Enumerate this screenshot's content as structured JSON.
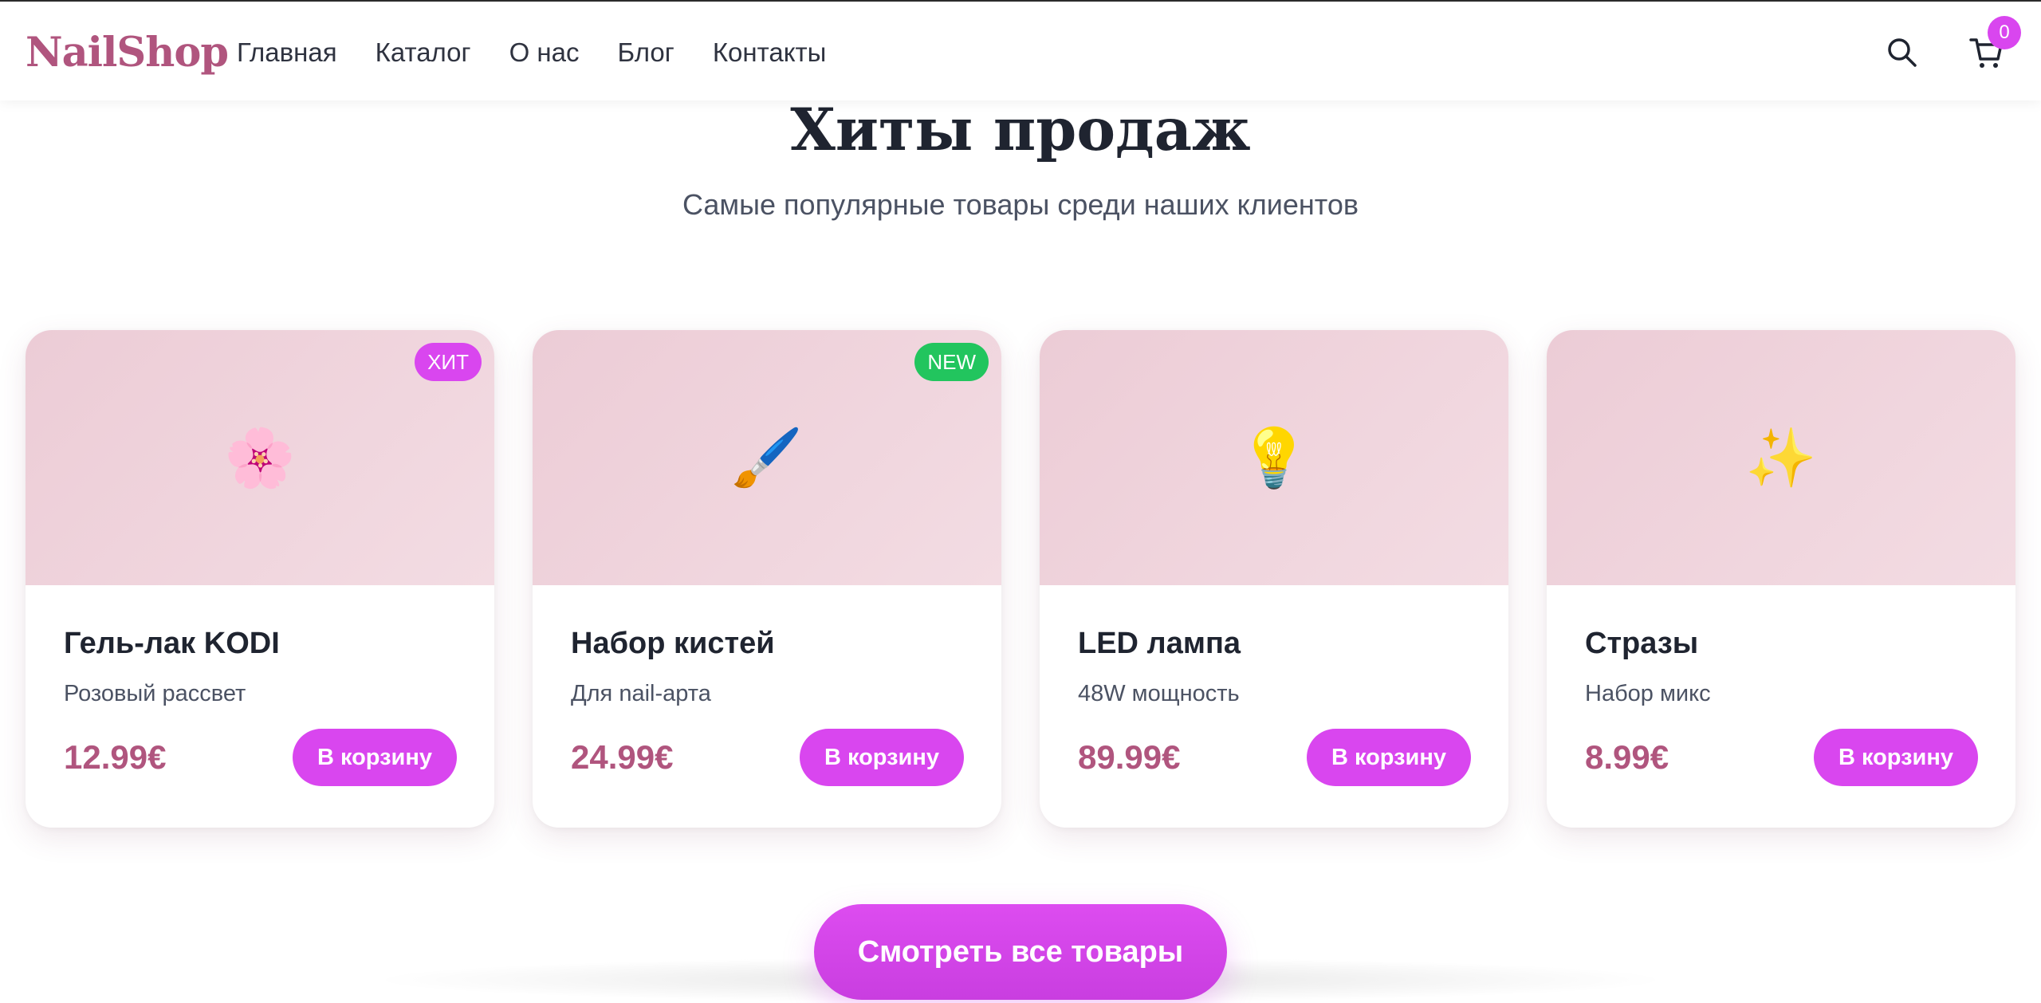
{
  "header": {
    "logo": "NailShop",
    "nav": [
      "Главная",
      "Каталог",
      "О нас",
      "Блог",
      "Контакты"
    ],
    "cart_count": "0"
  },
  "section": {
    "title": "Хиты продаж",
    "subtitle": "Самые популярные товары среди наших клиентов"
  },
  "products": [
    {
      "name": "Гель-лак KODI",
      "description": "Розовый рассвет",
      "price": "12.99€",
      "emoji": "🌸",
      "badge": "ХИТ",
      "badge_color": "#d946ef",
      "button": "В корзину"
    },
    {
      "name": "Набор кистей",
      "description": "Для nail-арта",
      "price": "24.99€",
      "emoji": "🖌️",
      "badge": "NEW",
      "badge_color": "#22c55e",
      "button": "В корзину"
    },
    {
      "name": "LED лампа",
      "description": "48W мощность",
      "price": "89.99€",
      "emoji": "💡",
      "badge": "",
      "badge_color": "",
      "button": "В корзину"
    },
    {
      "name": "Стразы",
      "description": "Набор микс",
      "price": "8.99€",
      "emoji": "✨",
      "badge": "",
      "badge_color": "",
      "button": "В корзину"
    }
  ],
  "view_all": "Смотреть все товары",
  "colors": {
    "brand": "#b0557e",
    "accent": "#d946ef",
    "new_badge": "#22c55e",
    "card_image_bg": "#ecccd6"
  }
}
